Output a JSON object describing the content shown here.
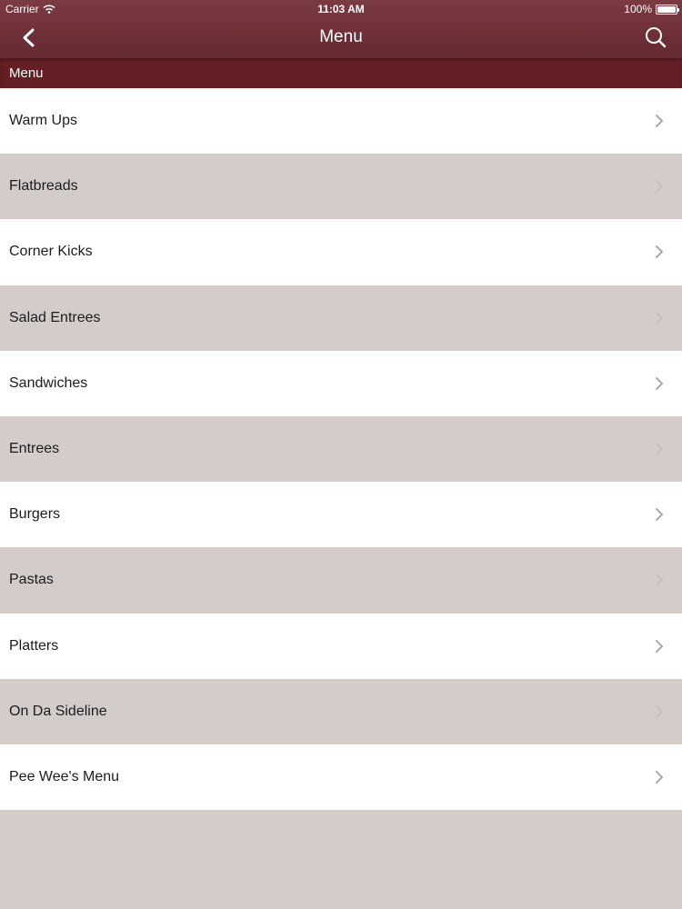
{
  "status_bar": {
    "carrier": "Carrier",
    "time": "11:03 AM",
    "battery": "100%"
  },
  "nav": {
    "title": "Menu",
    "back_icon": "chevron-left-icon",
    "search_icon": "search-icon"
  },
  "section": {
    "title": "Menu"
  },
  "menu": {
    "items": [
      {
        "label": "Warm Ups"
      },
      {
        "label": "Flatbreads"
      },
      {
        "label": "Corner Kicks"
      },
      {
        "label": "Salad Entrees"
      },
      {
        "label": "Sandwiches"
      },
      {
        "label": "Entrees"
      },
      {
        "label": "Burgers"
      },
      {
        "label": "Pastas"
      },
      {
        "label": "Platters"
      },
      {
        "label": "On Da Sideline"
      },
      {
        "label": "Pee Wee's Menu"
      }
    ]
  },
  "colors": {
    "nav_bar": "#6e2f37",
    "section_header": "#631f24",
    "row_alt": "#d4cbcb",
    "row": "#ffffff"
  }
}
